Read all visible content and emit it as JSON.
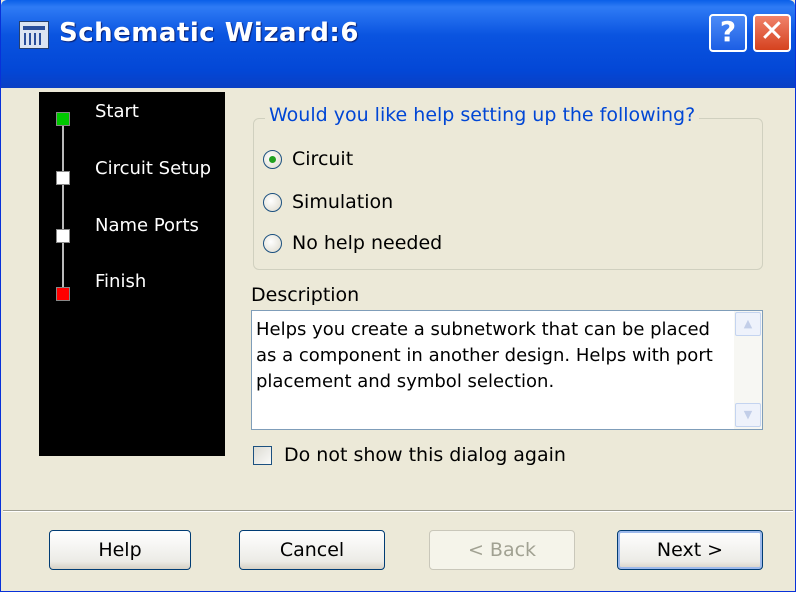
{
  "window": {
    "title": "Schematic Wizard:6",
    "help_glyph": "?",
    "close_glyph": "✕"
  },
  "steps": [
    {
      "label": "Start",
      "color": "#00c800"
    },
    {
      "label": "Circuit Setup",
      "color": "#ffffff"
    },
    {
      "label": "Name Ports",
      "color": "#ffffff"
    },
    {
      "label": "Finish",
      "color": "#ff0000"
    }
  ],
  "setup": {
    "legend": "Would you like help setting up the following?",
    "options": [
      {
        "label": "Circuit",
        "checked": true
      },
      {
        "label": "Simulation",
        "checked": false
      },
      {
        "label": "No help needed",
        "checked": false
      }
    ]
  },
  "description": {
    "label": "Description",
    "text": "Helps you create a subnetwork that can be placed as a component in another design. Helps with port placement and symbol selection.",
    "scroll_up_glyph": "▲",
    "scroll_down_glyph": "▼"
  },
  "dont_show": {
    "label": "Do not show this dialog again",
    "checked": false
  },
  "buttons": {
    "help": "Help",
    "cancel": "Cancel",
    "back": "< Back",
    "next": "Next >"
  },
  "colors": {
    "accent": "#0046d5",
    "titlebar": "#0a54e0"
  }
}
